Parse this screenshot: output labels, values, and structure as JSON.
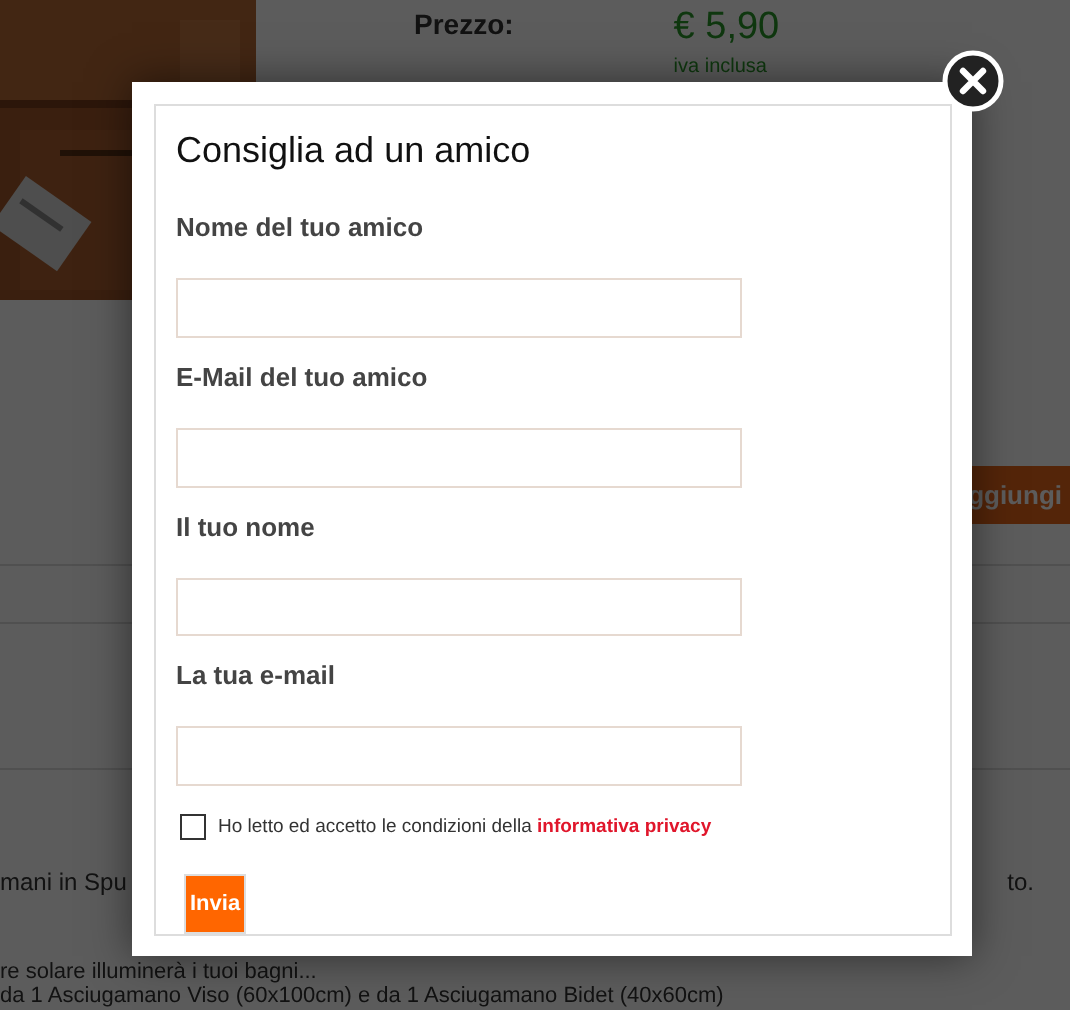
{
  "page": {
    "price_label": "Prezzo:",
    "price": "€ 5,90",
    "price_note": "iva inclusa",
    "add_button": "ggiungi",
    "description": {
      "first_line": {
        "start": "mani in Spu",
        "end": "to."
      },
      "lines": [
        "re solare illuminerà i tuoi bagni...",
        "da 1 Asciugamano Viso (60x100cm) e da 1 Asciugamano Bidet (40x60cm)"
      ]
    }
  },
  "modal": {
    "title": "Consiglia ad un amico",
    "fields": [
      {
        "label": "Nome del tuo amico"
      },
      {
        "label": "E-Mail del tuo amico"
      },
      {
        "label": "Il tuo nome"
      },
      {
        "label": "La tua e-mail"
      }
    ],
    "consent": {
      "text": "Ho letto ed accetto le condizioni della",
      "link": "informativa privacy",
      "checked": false
    },
    "submit": "Invia"
  }
}
